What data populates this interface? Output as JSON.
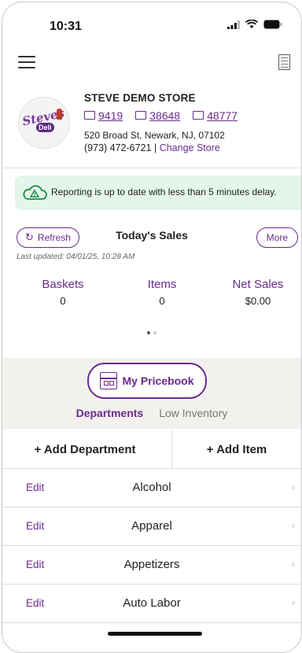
{
  "status_bar": {
    "time": "10:31"
  },
  "store": {
    "logo_text": "Steves",
    "logo_deli": "Deli",
    "name": "STEVE DEMO STORE",
    "registers": [
      "9419",
      "38648",
      "48777"
    ],
    "address": "520 Broad St, Newark, NJ, 07102",
    "phone": "(973) 472-6721",
    "separator": " | ",
    "change_store": "Change Store"
  },
  "banner": {
    "text": "Reporting is up to date with less than 5 minutes delay."
  },
  "sales": {
    "refresh_label": "Refresh",
    "title": "Today's Sales",
    "more_label": "More",
    "last_updated": "Last updated:  04/01/25, 10:28 AM",
    "metrics": [
      {
        "label": "Baskets",
        "value": "0"
      },
      {
        "label": "Items",
        "value": "0"
      },
      {
        "label": "Net Sales",
        "value": "$0.00"
      }
    ],
    "page_indicator": {
      "pages": 2,
      "active": 1
    }
  },
  "pricebook": {
    "button_label": "My Pricebook",
    "tabs": [
      {
        "label": "Departments",
        "active": true
      },
      {
        "label": "Low Inventory",
        "active": false
      }
    ]
  },
  "actions": {
    "add_department": "+ Add Department",
    "add_item": "+ Add Item"
  },
  "departments": [
    {
      "edit": "Edit",
      "name": "Alcohol"
    },
    {
      "edit": "Edit",
      "name": "Apparel"
    },
    {
      "edit": "Edit",
      "name": "Appetizers"
    },
    {
      "edit": "Edit",
      "name": "Auto Labor"
    }
  ],
  "colors": {
    "accent": "#6a2b8f",
    "banner_bg": "#e4f5ea",
    "section_bg": "#f2f1ee"
  }
}
